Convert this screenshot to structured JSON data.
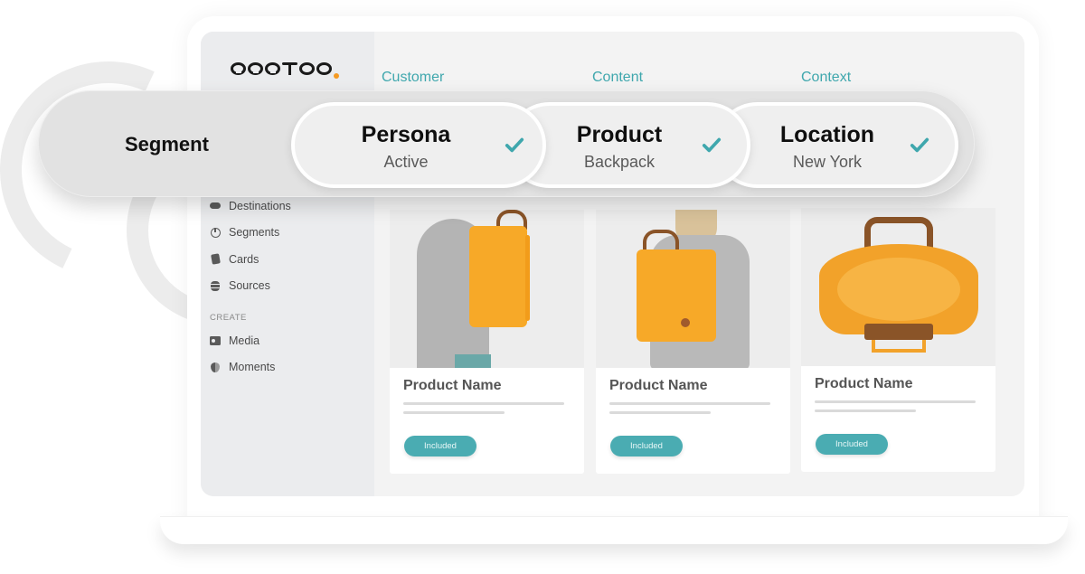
{
  "brand": {
    "logo_text": "occtoo",
    "accent_color": "#f59a23"
  },
  "sidebar": {
    "items": [
      {
        "label": "Destinations",
        "icon": "cloud-icon"
      },
      {
        "label": "Segments",
        "icon": "pie-chart-icon"
      },
      {
        "label": "Cards",
        "icon": "cards-icon"
      },
      {
        "label": "Sources",
        "icon": "database-icon"
      }
    ],
    "section_create": "CREATE",
    "create_items": [
      {
        "label": "Media",
        "icon": "image-icon"
      },
      {
        "label": "Moments",
        "icon": "heart-icon"
      }
    ]
  },
  "categories": {
    "customer": "Customer",
    "content": "Content",
    "context": "Context",
    "color": "#3fa7ad"
  },
  "segment": {
    "label": "Segment",
    "pills": [
      {
        "title": "Persona",
        "value": "Active",
        "checked": true
      },
      {
        "title": "Product",
        "value": "Backpack",
        "checked": true
      },
      {
        "title": "Location",
        "value": "New York",
        "checked": true
      }
    ],
    "check_color": "#3fa7ad"
  },
  "products": [
    {
      "name": "Product Name",
      "status": "Included",
      "image": "yellow backpack worn by man"
    },
    {
      "name": "Product Name",
      "status": "Included",
      "image": "yellow backpack worn by woman"
    },
    {
      "name": "Product Name",
      "status": "Included",
      "image": "open yellow tote bag"
    }
  ],
  "badge_color": "#4aacb2"
}
